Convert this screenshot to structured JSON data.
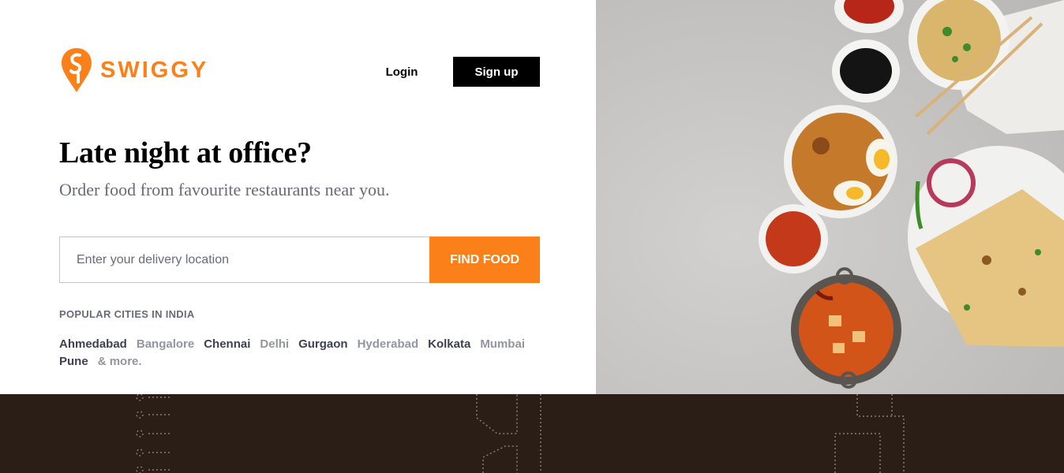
{
  "brand": {
    "name": "SWIGGY",
    "color": "#fc8019"
  },
  "nav": {
    "login_label": "Login",
    "signup_label": "Sign up"
  },
  "hero": {
    "headline": "Late night at office?",
    "subline": "Order food from favourite restaurants near you."
  },
  "search": {
    "placeholder": "Enter your delivery location",
    "value": "",
    "button_label": "FIND FOOD"
  },
  "popular": {
    "title": "POPULAR CITIES IN INDIA",
    "cities": [
      {
        "name": "Ahmedabad",
        "tone": "dark"
      },
      {
        "name": "Bangalore",
        "tone": "light"
      },
      {
        "name": "Chennai",
        "tone": "dark"
      },
      {
        "name": "Delhi",
        "tone": "light"
      },
      {
        "name": "Gurgaon",
        "tone": "dark"
      },
      {
        "name": "Hyderabad",
        "tone": "light"
      },
      {
        "name": "Kolkata",
        "tone": "dark"
      },
      {
        "name": "Mumbai",
        "tone": "light"
      },
      {
        "name": "Pune",
        "tone": "dark"
      },
      {
        "name": "& more.",
        "tone": "light"
      }
    ]
  },
  "colors": {
    "accent": "#fc8019",
    "footer_bg": "#2b1e16",
    "city_dark": "#3d4152",
    "city_light": "#93959f"
  }
}
